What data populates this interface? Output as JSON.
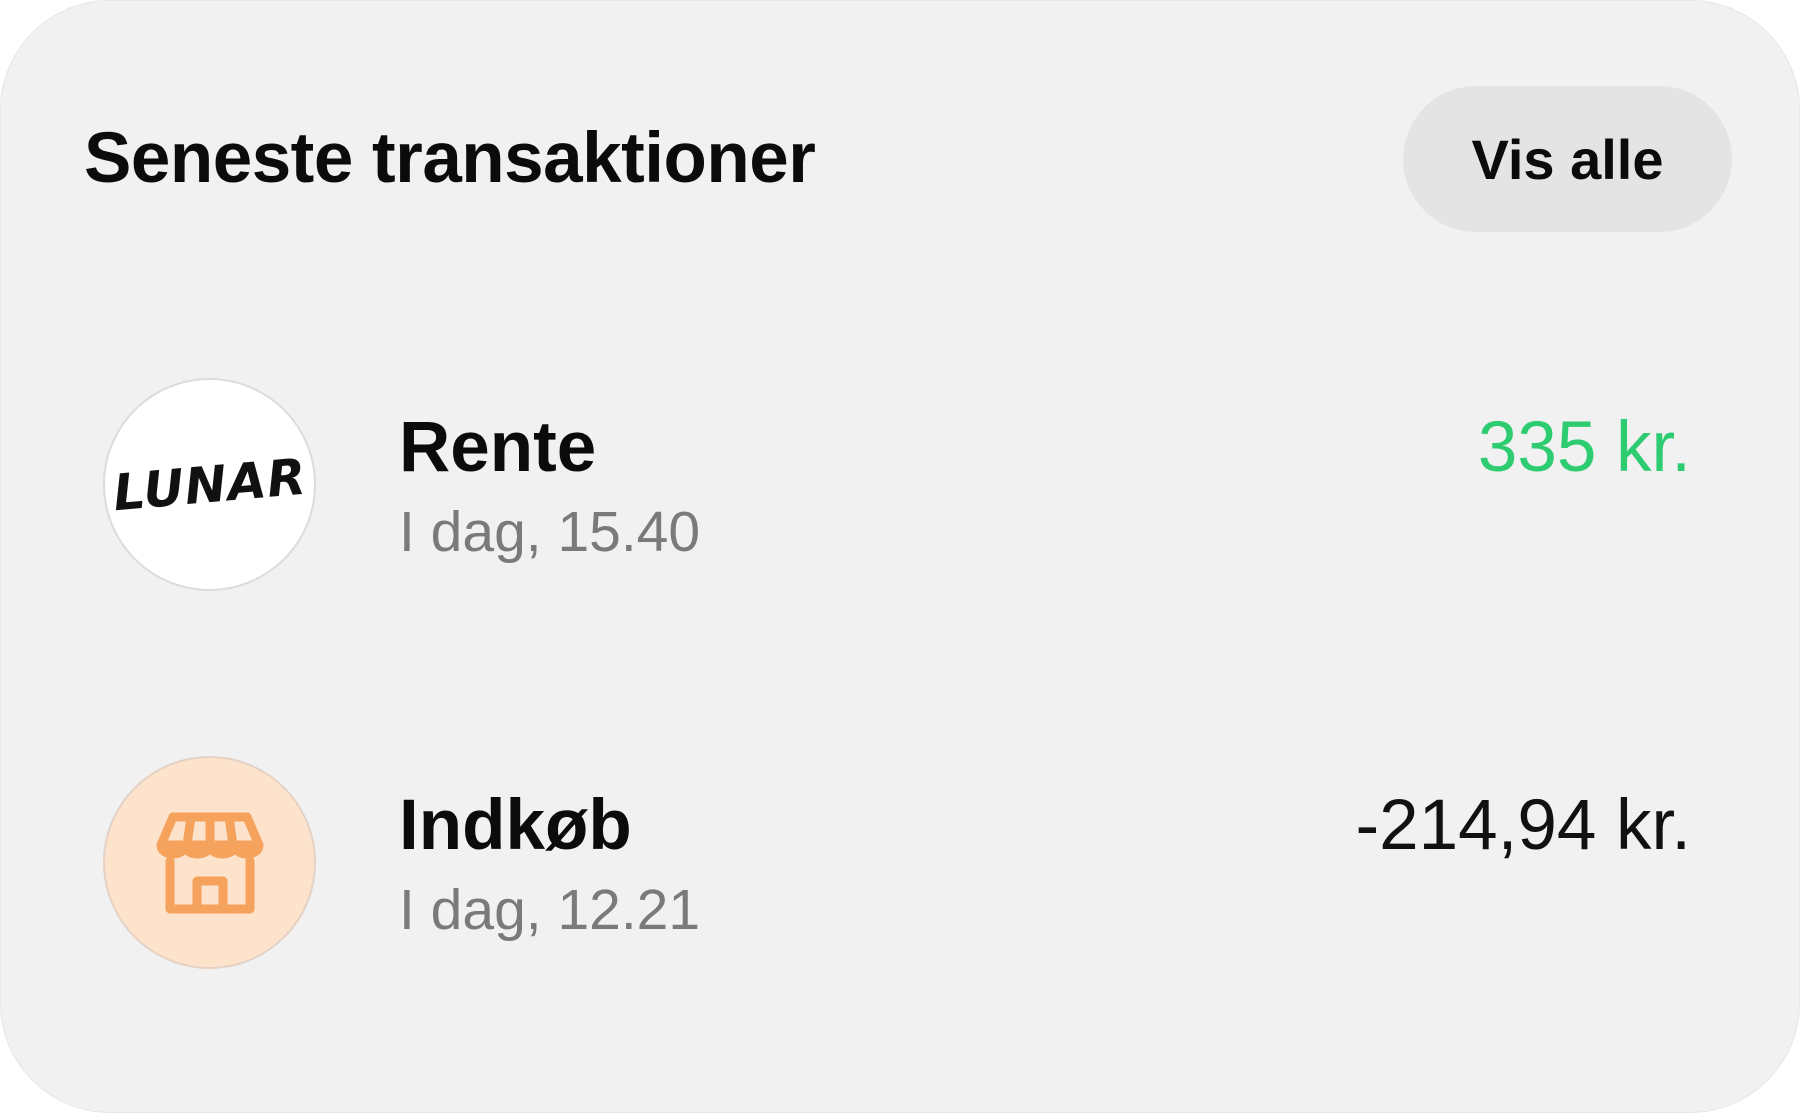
{
  "header": {
    "title": "Seneste transaktioner",
    "view_all_label": "Vis alle"
  },
  "transactions": [
    {
      "logo_text": "LUNAR",
      "icon": "lunar-logo",
      "name": "Rente",
      "time": "I dag, 15.40",
      "amount": "335 kr.",
      "amount_color": "#2ecc71"
    },
    {
      "icon": "storefront-icon",
      "icon_color": "#f5a25d",
      "name": "Indkøb",
      "time": "I dag, 12.21",
      "amount": "-214,94 kr.",
      "amount_color": "#111111"
    }
  ],
  "colors": {
    "card_background": "#f1f1f1",
    "button_background": "#e4e4e4",
    "positive": "#2ecc71",
    "shop_icon_background": "#fde2cc"
  }
}
